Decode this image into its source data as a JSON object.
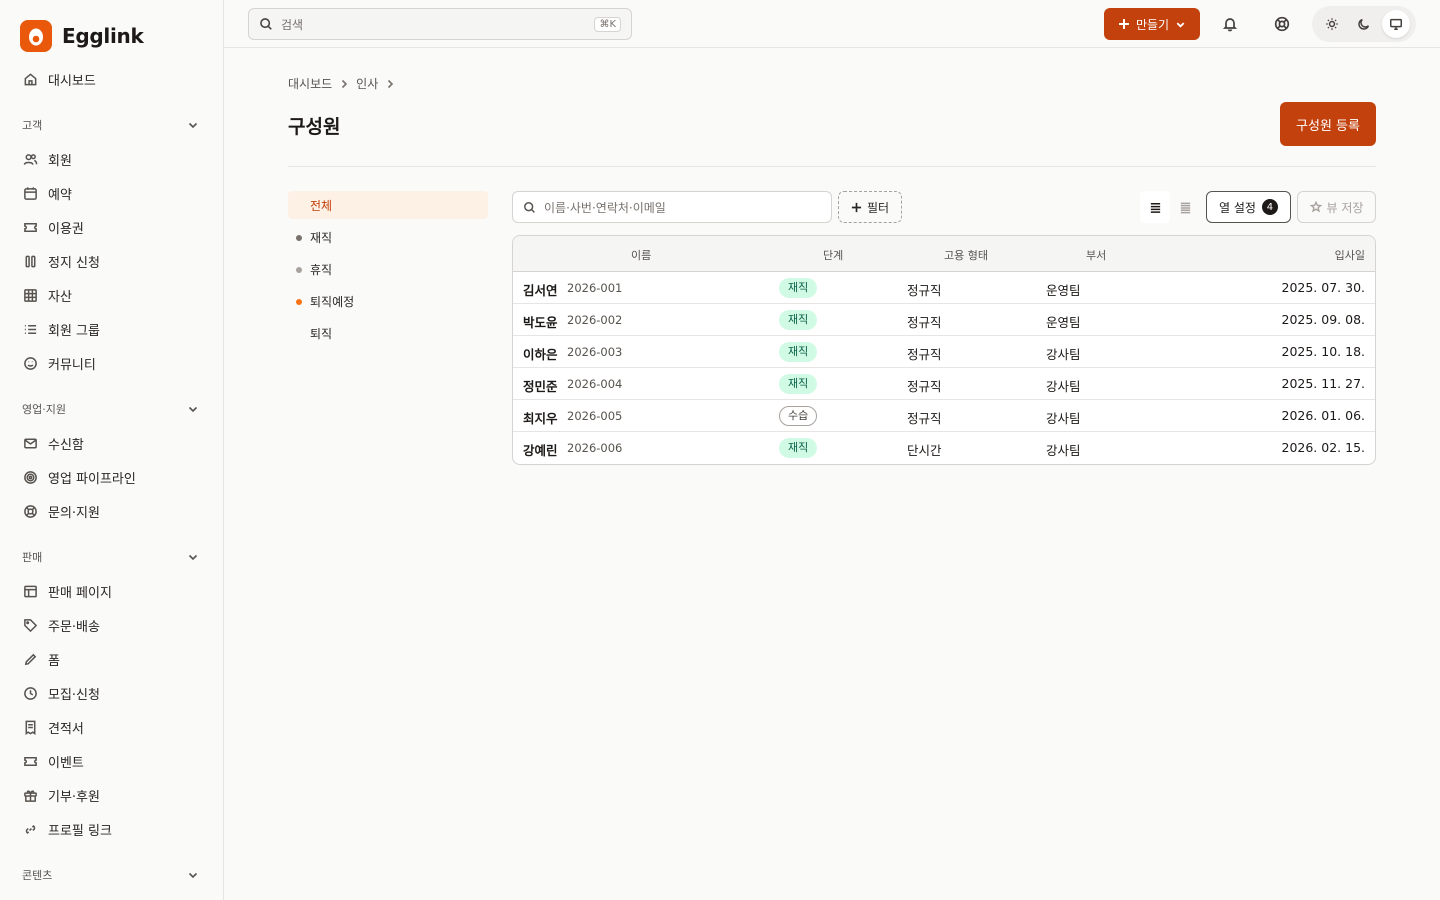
{
  "app": {
    "name": "Egglink"
  },
  "sidebar": {
    "top": [
      {
        "label": "대시보드",
        "icon": "home-icon"
      }
    ],
    "sections": [
      {
        "title": "고객",
        "items": [
          {
            "label": "회원",
            "icon": "users-icon"
          },
          {
            "label": "예약",
            "icon": "calendar-icon"
          },
          {
            "label": "이용권",
            "icon": "ticket-icon"
          },
          {
            "label": "정지 신청",
            "icon": "pause-icon"
          },
          {
            "label": "자산",
            "icon": "grid-icon"
          },
          {
            "label": "회원 그룹",
            "icon": "list-icon"
          },
          {
            "label": "커뮤니티",
            "icon": "smile-icon"
          }
        ]
      },
      {
        "title": "영업·지원",
        "items": [
          {
            "label": "수신함",
            "icon": "mail-icon"
          },
          {
            "label": "영업 파이프라인",
            "icon": "target-icon"
          },
          {
            "label": "문의·지원",
            "icon": "lifebuoy-icon"
          }
        ]
      },
      {
        "title": "판매",
        "items": [
          {
            "label": "판매 페이지",
            "icon": "layout-icon"
          },
          {
            "label": "주문·배송",
            "icon": "tag-icon"
          },
          {
            "label": "폼",
            "icon": "pencil-icon"
          },
          {
            "label": "모집·신청",
            "icon": "clock-icon"
          },
          {
            "label": "견적서",
            "icon": "receipt-icon"
          },
          {
            "label": "이벤트",
            "icon": "ticket-icon"
          },
          {
            "label": "기부·후원",
            "icon": "gift-icon"
          },
          {
            "label": "프로필 링크",
            "icon": "link-icon"
          }
        ]
      },
      {
        "title": "콘텐츠",
        "items": []
      }
    ]
  },
  "topbar": {
    "search_placeholder": "검색",
    "shortcut": "⌘K",
    "create_label": "만들기"
  },
  "page": {
    "breadcrumb": [
      "대시보드",
      "인사"
    ],
    "title": "구성원",
    "primary_action": "구성원 등록"
  },
  "statuses": [
    {
      "label": "전체",
      "active": true,
      "dot": ""
    },
    {
      "label": "재직",
      "active": false,
      "dot": "#78716c"
    },
    {
      "label": "휴직",
      "active": false,
      "dot": "#a8a29e"
    },
    {
      "label": "퇴직예정",
      "active": false,
      "dot": "#f97316"
    },
    {
      "label": "퇴직",
      "active": false,
      "dot": ""
    }
  ],
  "toolbar": {
    "search_placeholder": "이름·사번·연락처·이메일",
    "filter_label": "필터",
    "columns_label": "열 설정",
    "columns_count": "4",
    "save_view_label": "뷰 저장"
  },
  "table": {
    "headers": {
      "name": "이름",
      "stage": "단계",
      "employment": "고용 형태",
      "dept": "부서",
      "joined": "입사일"
    },
    "rows": [
      {
        "name": "김서연",
        "id": "2026-001",
        "stage": "재직",
        "stage_style": "green",
        "employment": "정규직",
        "dept": "운영팀",
        "joined": "2025. 07. 30."
      },
      {
        "name": "박도윤",
        "id": "2026-002",
        "stage": "재직",
        "stage_style": "green",
        "employment": "정규직",
        "dept": "운영팀",
        "joined": "2025. 09. 08."
      },
      {
        "name": "이하은",
        "id": "2026-003",
        "stage": "재직",
        "stage_style": "green",
        "employment": "정규직",
        "dept": "강사팀",
        "joined": "2025. 10. 18."
      },
      {
        "name": "정민준",
        "id": "2026-004",
        "stage": "재직",
        "stage_style": "green",
        "employment": "정규직",
        "dept": "강사팀",
        "joined": "2025. 11. 27."
      },
      {
        "name": "최지우",
        "id": "2026-005",
        "stage": "수습",
        "stage_style": "outline",
        "employment": "정규직",
        "dept": "강사팀",
        "joined": "2026. 01. 06."
      },
      {
        "name": "강예린",
        "id": "2026-006",
        "stage": "재직",
        "stage_style": "green",
        "employment": "단시간",
        "dept": "강사팀",
        "joined": "2026. 02. 15."
      }
    ]
  },
  "colors": {
    "accent": "#c2410c",
    "active_bg": "#fdf0e4",
    "stage_green_bg": "#d1fae5"
  }
}
